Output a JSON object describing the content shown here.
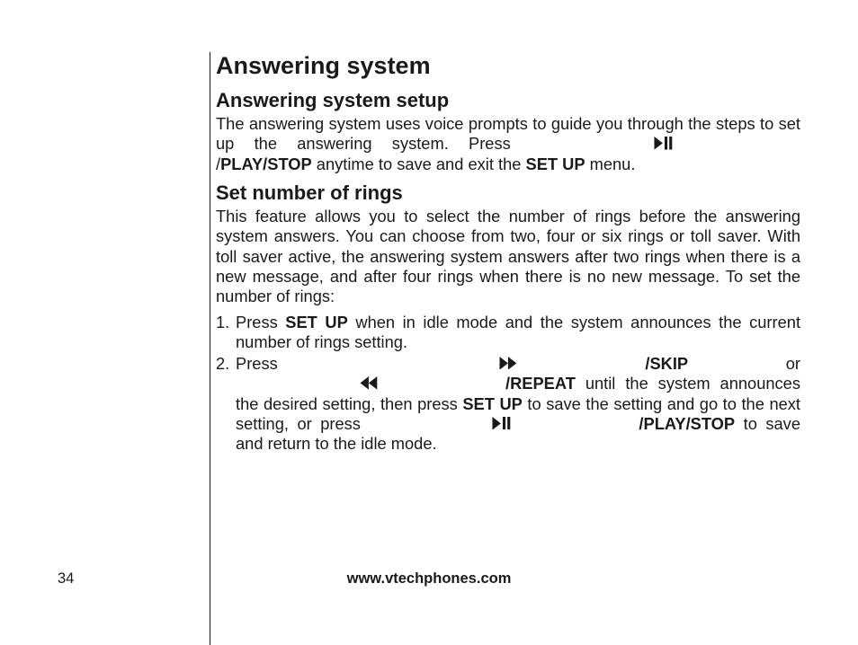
{
  "page": {
    "number": "34",
    "footer": "www.vtechphones.com"
  },
  "h1": "Answering system",
  "section1": {
    "heading": "Answering system setup",
    "p_a": "The answering system uses voice prompts to guide you through the steps to set up the answering system. Press ",
    "icon1": "play-pause",
    "p_b": "/",
    "p_b_bold": "PLAY/STOP",
    "p_c": " anytime to save and exit the ",
    "p_c_bold": "SET UP",
    "p_d": " menu."
  },
  "section2": {
    "heading": "Set number of rings",
    "p": "This feature allows you to select the number of rings before the answering system answers. You can choose from two, four or six rings or toll saver. With toll saver active, the answering system answers after two rings when there is a new message, and after four rings when there is no new message. To set the number of rings:",
    "list": {
      "n1": "1.",
      "item1_a": "Press ",
      "item1_a_bold": "SET UP",
      "item1_b": " when in idle mode and the system announces the current number of rings setting.",
      "n2": "2.",
      "item2_a": "Press ",
      "item2_skip_bold": "/SKIP",
      "item2_b": " or ",
      "item2_repeat_bold": "/REPEAT",
      "item2_c": " until the system announces the desired setting, then press ",
      "item2_setup_bold": "SET UP",
      "item2_d": " to save the setting and go to the next setting, or press ",
      "item2_playstop_bold": "/PLAY/STOP",
      "item2_e": " to save and return to the idle mode."
    }
  }
}
